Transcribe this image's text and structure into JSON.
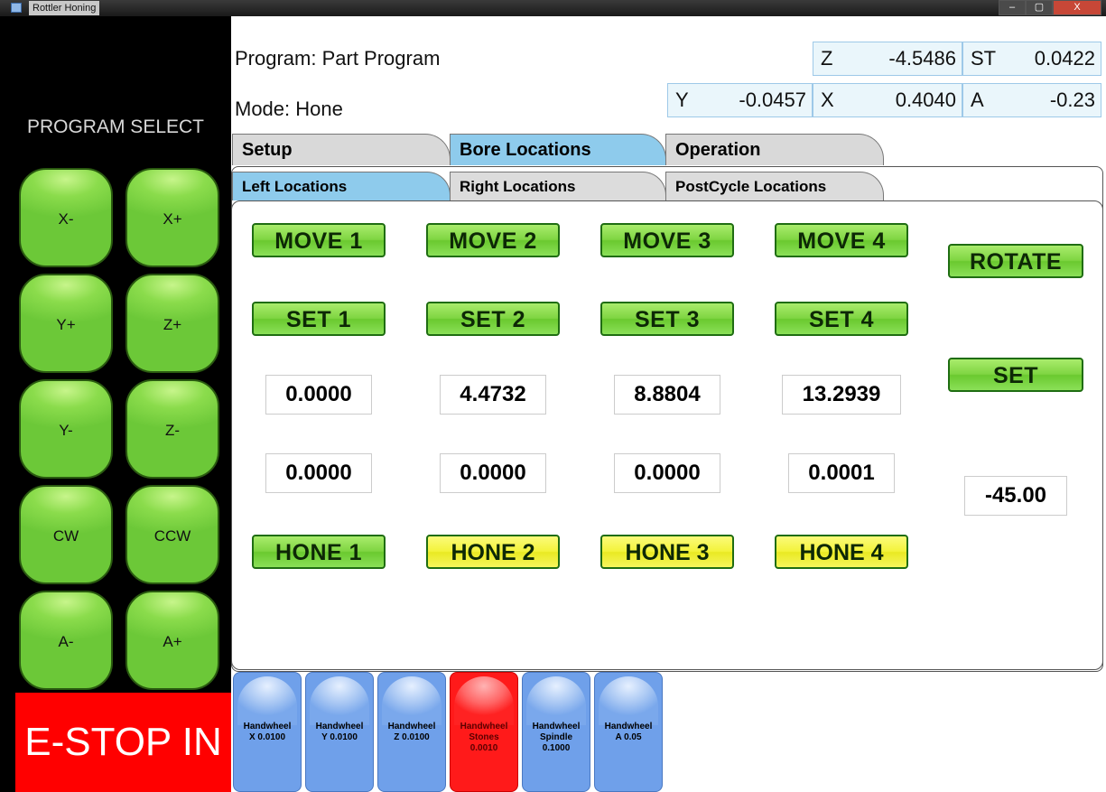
{
  "window": {
    "title": "Rottler Honing",
    "controls": [
      "–",
      "▢",
      "X"
    ]
  },
  "left": {
    "program_select": "PROGRAM SELECT",
    "jog_buttons": [
      "X-",
      "X+",
      "Y+",
      "Z+",
      "Y-",
      "Z-",
      "CW",
      "CCW",
      "A-",
      "A+"
    ],
    "estop": "E-STOP IN"
  },
  "header": {
    "program": "Program: Part Program",
    "mode": "Mode: Hone",
    "axes": {
      "z": {
        "label": "Z",
        "value": "-4.5486"
      },
      "st": {
        "label": "ST",
        "value": "0.0422"
      },
      "y": {
        "label": "Y",
        "value": "-0.0457"
      },
      "x": {
        "label": "X",
        "value": "0.4040"
      },
      "a": {
        "label": "A",
        "value": "-0.23"
      }
    }
  },
  "tabs": [
    "Setup",
    "Bore Locations",
    "Operation"
  ],
  "subtabs": [
    "Left Locations",
    "Right Locations",
    "PostCycle Locations"
  ],
  "main": {
    "move": [
      "MOVE 1",
      "MOVE 2",
      "MOVE 3",
      "MOVE 4"
    ],
    "set": [
      "SET 1",
      "SET 2",
      "SET 3",
      "SET 4"
    ],
    "row1": [
      "0.0000",
      "4.4732",
      "8.8804",
      "13.2939"
    ],
    "row2": [
      "0.0000",
      "0.0000",
      "0.0000",
      "0.0001"
    ],
    "hone": [
      "HONE 1",
      "HONE 2",
      "HONE 3",
      "HONE 4"
    ],
    "rotate": "ROTATE",
    "set_angle": "SET",
    "angle": "-45.00"
  },
  "handwheels": [
    {
      "line1": "Handwheel",
      "line2": "X 0.0100",
      "line3": ""
    },
    {
      "line1": "Handwheel",
      "line2": "Y 0.0100",
      "line3": ""
    },
    {
      "line1": "Handwheel",
      "line2": "Z 0.0100",
      "line3": ""
    },
    {
      "line1": "Handwheel",
      "line2": "Stones",
      "line3": "0.0010"
    },
    {
      "line1": "Handwheel",
      "line2": "Spindle",
      "line3": "0.1000"
    },
    {
      "line1": "Handwheel",
      "line2": "A 0.05",
      "line3": ""
    }
  ],
  "colors": {
    "jog_green": "#7fd542",
    "hone_yellow": "#f3f33c",
    "estop_red": "#ff0000",
    "active_tab": "#8ecbec",
    "handwheel_blue": "#6fa0ea",
    "handwheel_active": "#ff1a1a"
  }
}
